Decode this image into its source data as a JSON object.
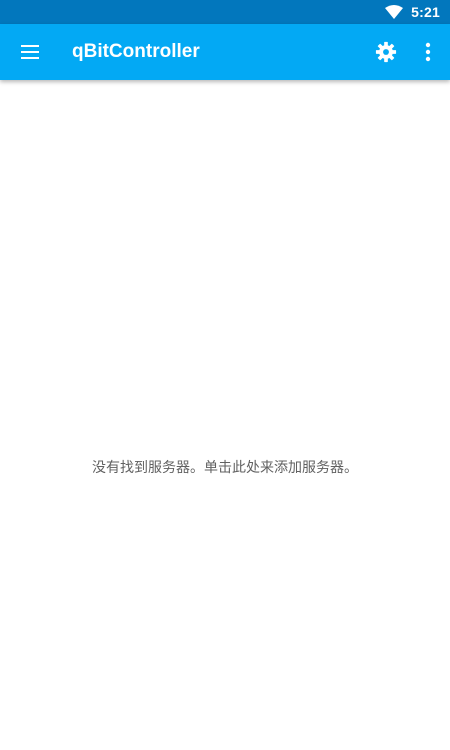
{
  "status_bar": {
    "time": "5:21",
    "wifi_icon": "wifi-icon",
    "background_color": "#0277bd"
  },
  "app_bar": {
    "title": "qBitController",
    "menu_icon": "hamburger-menu-icon",
    "settings_icon": "gear-icon",
    "more_icon": "more-vert-icon",
    "background_color": "#03a9f4"
  },
  "main": {
    "empty_message": "没有找到服务器。单击此处来添加服务器。"
  }
}
